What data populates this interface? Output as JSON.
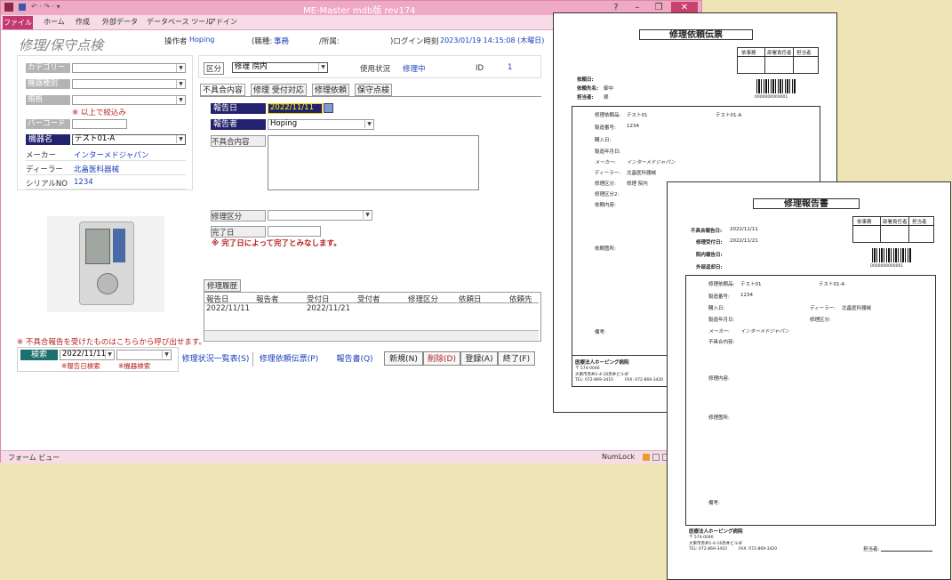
{
  "window": {
    "title": "ME-Master mdb版 rev174",
    "ribbon_tabs": [
      "ファイル",
      "ホーム",
      "作成",
      "外部データ",
      "データベース ツール",
      "アドイン"
    ]
  },
  "header": {
    "form_title": "修理/保守点検",
    "operator_label": "操作者",
    "operator": "Hoping",
    "job_label": "(職種:",
    "job": "事務",
    "dept_label": "/所属:",
    "login_label": ")ログイン時刻",
    "login_time": "2023/01/19 14:15:08 (木曜日)"
  },
  "left": {
    "category_label": "カテゴリー",
    "type_label": "機器種別",
    "spec_label": "規格",
    "narrow_note": "※ 以上で絞込み",
    "barcode_label": "バーコード",
    "device_label": "機器名",
    "device_value": "テスト01-A",
    "maker_label": "メーカー",
    "maker_value": "インターメドジャパン",
    "dealer_label": "ディーラー",
    "dealer_value": "北畠医科器械",
    "serial_label": "シリアルNO",
    "serial_value": "1234"
  },
  "right": {
    "kubun_label": "区分",
    "kubun_value": "修理  院内",
    "status_label": "使用状況",
    "status_value": "修理中",
    "id_label": "ID",
    "id_value": "1",
    "tabs": [
      "不具合内容",
      "修理 受付対応",
      "修理依頼",
      "保守点検"
    ],
    "report_date_label": "報告日",
    "report_date_value": "2022/11/11",
    "reporter_label": "報告者",
    "reporter_value": "Hoping",
    "defect_label": "不具合内容",
    "repair_kubun_label": "修理区分",
    "done_date_label": "完了日",
    "done_note": "※ 完了日によって完了とみなします。"
  },
  "history": {
    "title": "修理履歴",
    "columns": [
      "報告日",
      "報告者",
      "受付日",
      "受付者",
      "修理区分",
      "依頼日",
      "依頼先"
    ],
    "rows": [
      [
        "2022/11/11",
        "",
        "2022/11/21",
        "",
        "",
        "",
        ""
      ]
    ]
  },
  "bottom": {
    "note": "※ 不具合報告を受けたものはこちらから呼び出せます。",
    "search_label": "検索",
    "search_date": "2022/11/11",
    "search_hint1": "※報告日検索",
    "search_hint2": "※機器検索",
    "link_status_list": "修理状況一覧表(S)",
    "link_request_slip": "修理依頼伝票(P)",
    "link_report": "報告書(Q)",
    "btn_new": "新規(N)",
    "btn_delete": "削除(D)",
    "btn_register": "登録(A)",
    "btn_close": "終了(F)"
  },
  "statusbar": {
    "left": "フォーム ビュー",
    "numlock": "NumLock"
  },
  "report1": {
    "title": "修理依頼伝票",
    "stamp_cells": [
      "依事務",
      "部署責任者",
      "担当者"
    ],
    "barcode_number": "0000000000001",
    "fields": [
      "依頼日:",
      "依頼先名:",
      "担当者:"
    ],
    "field_values": [
      "",
      "御中",
      "様"
    ],
    "rows": [
      {
        "k": "修理依頼品:",
        "v": "テスト01",
        "v2": "テスト01-A"
      },
      {
        "k": "製造番号:",
        "v": "1234"
      },
      {
        "k": "購入日:",
        "v": ""
      },
      {
        "k": "製造年月日:",
        "v": ""
      },
      {
        "k": "メーカー:",
        "v": "インターメドジャパン"
      },
      {
        "k": "ディーラー:",
        "v": "北畠医科器械"
      },
      {
        "k": "修理区分:",
        "v": "修理  院内"
      },
      {
        "k": "修理区分2:",
        "v": ""
      },
      {
        "k": "依頼内容:",
        "v": ""
      },
      {
        "k": "依頼箇所:",
        "v": ""
      }
    ]
  },
  "report2": {
    "title": "修理報告書",
    "stamp_cells": [
      "依事務",
      "部署責任者",
      "担当者"
    ],
    "barcode_number": "0000000000001",
    "dates": [
      {
        "k": "不具合報告日:",
        "v": "2022/11/11"
      },
      {
        "k": "修理受付日:",
        "v": "2022/11/21"
      },
      {
        "k": "院内報告日:",
        "v": ""
      },
      {
        "k": "外部返却日:",
        "v": ""
      }
    ],
    "rows": [
      {
        "k": "修理依頼品:",
        "v": "テスト01",
        "v2": "テスト01-A"
      },
      {
        "k": "製造番号:",
        "v": "1234"
      },
      {
        "k": "購入日:",
        "v": "",
        "k2": "ディーラー:",
        "v3": "北畠医科器械"
      },
      {
        "k": "製造年月日:",
        "v": "",
        "k2": "修理区分:",
        "v3": ""
      },
      {
        "k": "メーカー:",
        "v": "インターメドジャパン"
      },
      {
        "k": "不具合内容:",
        "v": ""
      },
      {
        "k": "修理内容:",
        "v": ""
      },
      {
        "k": "修理箇所:",
        "v": ""
      },
      {
        "k": "備考:",
        "v": ""
      }
    ],
    "footer_org": "医療法人ホーピング病院",
    "footer_zip": "〒 574-0046",
    "footer_addr": "大東市赤井1-4-16赤井ビル4F",
    "footer_tel": "TEL: 072-869-3410",
    "footer_fax": "FAX: 072-869-3420",
    "footer_sign": "担当者:"
  },
  "report1_footer": {
    "org": "医療法人ホーピング病院",
    "zip": "〒 574-0046",
    "addr": "大東市赤井1-4-16赤井ビル4F",
    "tel": "TEL: 072-869-3410",
    "fax": "FAX: 072-869-3420",
    "note": "備考:"
  }
}
